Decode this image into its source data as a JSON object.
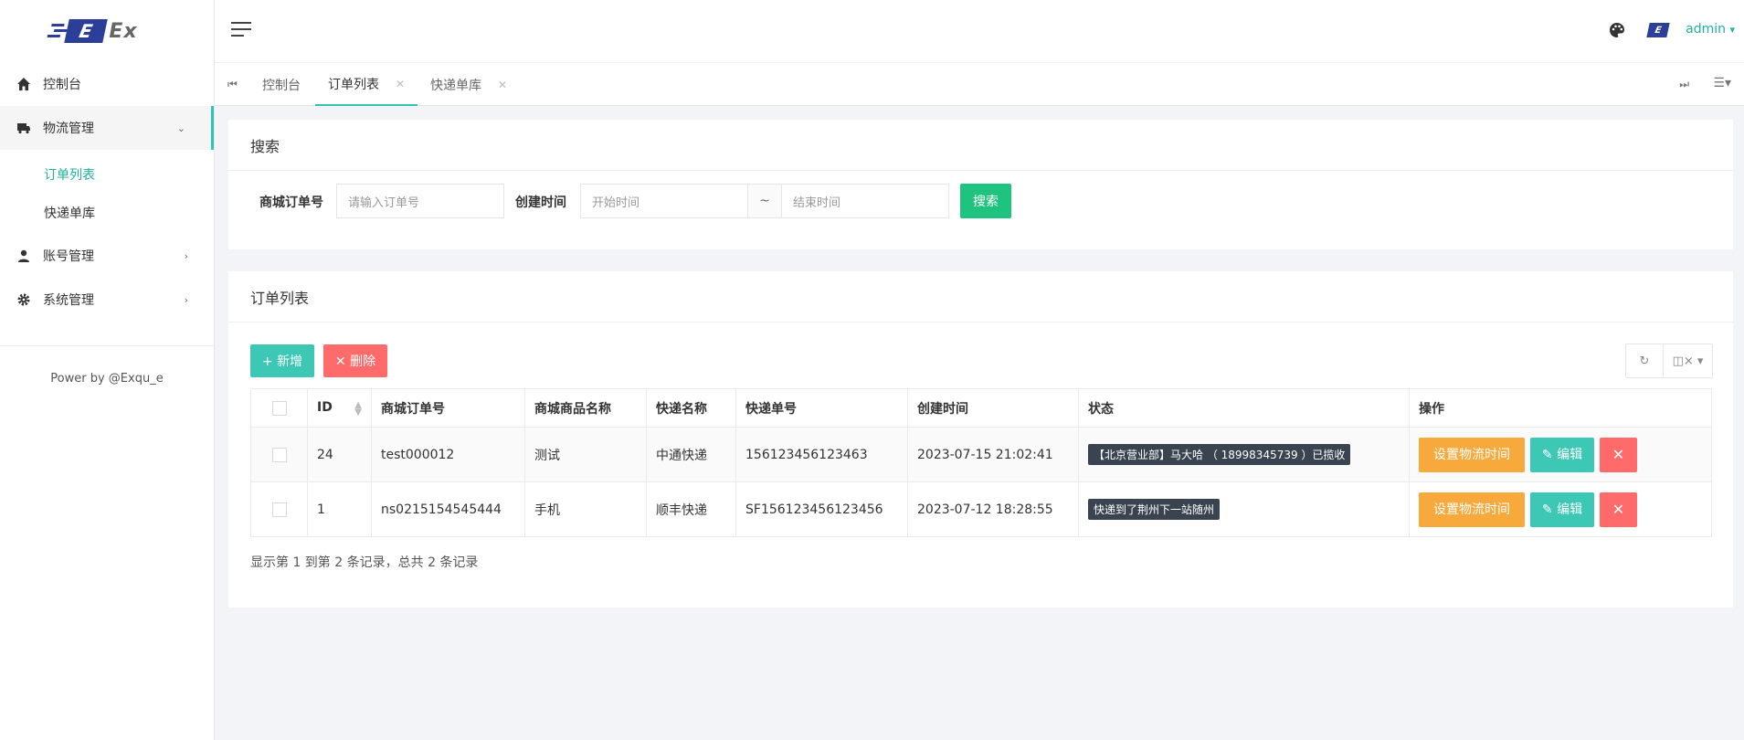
{
  "brand": {
    "logo_mark": "E",
    "logo_text": "Ex"
  },
  "header": {
    "user": "admin",
    "user_caret": "▾",
    "avatar_mark": "E"
  },
  "sidebar": {
    "items": [
      {
        "label": "控制台",
        "icon": "home-icon"
      },
      {
        "label": "物流管理",
        "icon": "truck-icon",
        "expanded": true
      },
      {
        "label": "账号管理",
        "icon": "user-icon"
      },
      {
        "label": "系统管理",
        "icon": "gear-icon"
      }
    ],
    "sub_items": [
      {
        "label": "订单列表",
        "active": true
      },
      {
        "label": "快递单库"
      }
    ],
    "footer": "Power by @Exqu_e"
  },
  "tabs": [
    {
      "label": "控制台"
    },
    {
      "label": "订单列表",
      "active": true
    },
    {
      "label": "快递单库"
    }
  ],
  "search": {
    "title": "搜索",
    "order_label": "商城订单号",
    "order_placeholder": "请输入订单号",
    "time_label": "创建时间",
    "start_placeholder": "开始时间",
    "range_sep": "~",
    "end_placeholder": "结束时间",
    "button": "搜索"
  },
  "list": {
    "title": "订单列表",
    "add_button": "+ 新增",
    "delete_button": "✕ 删除",
    "columns": [
      "ID",
      "商城订单号",
      "商城商品名称",
      "快递名称",
      "快递单号",
      "创建时间",
      "状态",
      "操作"
    ],
    "rows": [
      {
        "id": "24",
        "order_no": "test000012",
        "product": "测试",
        "courier": "中通快递",
        "tracking": "156123456123463",
        "created": "2023-07-15 21:02:41",
        "status": "【北京营业部】马大哈 （ 18998345739 ）已揽收"
      },
      {
        "id": "1",
        "order_no": "ns0215154545444",
        "product": "手机",
        "courier": "顺丰快递",
        "tracking": "SF156123456123456",
        "created": "2023-07-12 18:28:55",
        "status": "快递到了荆州下一站随州"
      }
    ],
    "actions": {
      "set_time": "设置物流时间",
      "edit": "✎ 编辑",
      "remove": "✕"
    },
    "summary": "显示第 1 到第 2 条记录，总共 2 条记录"
  },
  "colors": {
    "accent": "#2ec4b6",
    "search_btn": "#1ec37e",
    "danger": "#ff6b6b",
    "warning": "#f8a93c",
    "brand": "#2b3f98"
  }
}
